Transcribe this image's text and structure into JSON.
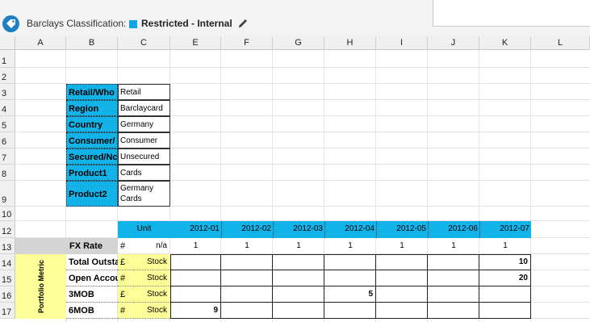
{
  "classification": {
    "label": "Barclays Classification:",
    "value": "Restricted - Internal",
    "square_color": "#12a5e6"
  },
  "columns": [
    "A",
    "B",
    "C",
    "E",
    "F",
    "G",
    "H",
    "I",
    "J",
    "K",
    "L"
  ],
  "rows": [
    "1",
    "2",
    "3",
    "4",
    "5",
    "6",
    "7",
    "8",
    "9",
    "10",
    "12",
    "13",
    "14",
    "15",
    "16",
    "17"
  ],
  "info_table": [
    {
      "label": "Retail/Who",
      "value": "Retail"
    },
    {
      "label": "Region",
      "value": "Barclaycard"
    },
    {
      "label": "Country",
      "value": "Germany"
    },
    {
      "label": "Consumer/",
      "value": "Consumer"
    },
    {
      "label": "Secured/Nc",
      "value": "Unsecured"
    },
    {
      "label": "Product1",
      "value": "Cards"
    },
    {
      "label": "Product2",
      "value": "Germany Cards"
    }
  ],
  "header_row": {
    "unit_label": "Unit",
    "periods": [
      "2012-01",
      "2012-02",
      "2012-03",
      "2012-04",
      "2012-05",
      "2012-06",
      "2012-07"
    ]
  },
  "fx_row": {
    "label": "FX Rate",
    "symbol": "#",
    "unit": "n/a",
    "values": [
      "1",
      "1",
      "1",
      "1",
      "1",
      "1",
      "1"
    ]
  },
  "side_label": "Portfolio Metric",
  "metrics": [
    {
      "label": "Total Outsta",
      "symbol": "£",
      "unit": "Stock",
      "values": [
        "",
        "",
        "",
        "",
        "",
        "",
        "10"
      ]
    },
    {
      "label": "Open Accou",
      "symbol": "#",
      "unit": "Stock",
      "values": [
        "",
        "",
        "",
        "",
        "",
        "",
        "20"
      ]
    },
    {
      "label": "3MOB",
      "symbol": "£",
      "unit": "Stock",
      "values": [
        "",
        "",
        "",
        "5",
        "",
        "",
        ""
      ]
    },
    {
      "label": "6MOB",
      "symbol": "#",
      "unit": "Stock",
      "values": [
        "9",
        "",
        "",
        "",
        "",
        "",
        ""
      ]
    }
  ],
  "colors": {
    "accent_blue": "#12b3e8",
    "fx_grey": "#d4d4d4",
    "side_yellow": "#ffff99"
  }
}
